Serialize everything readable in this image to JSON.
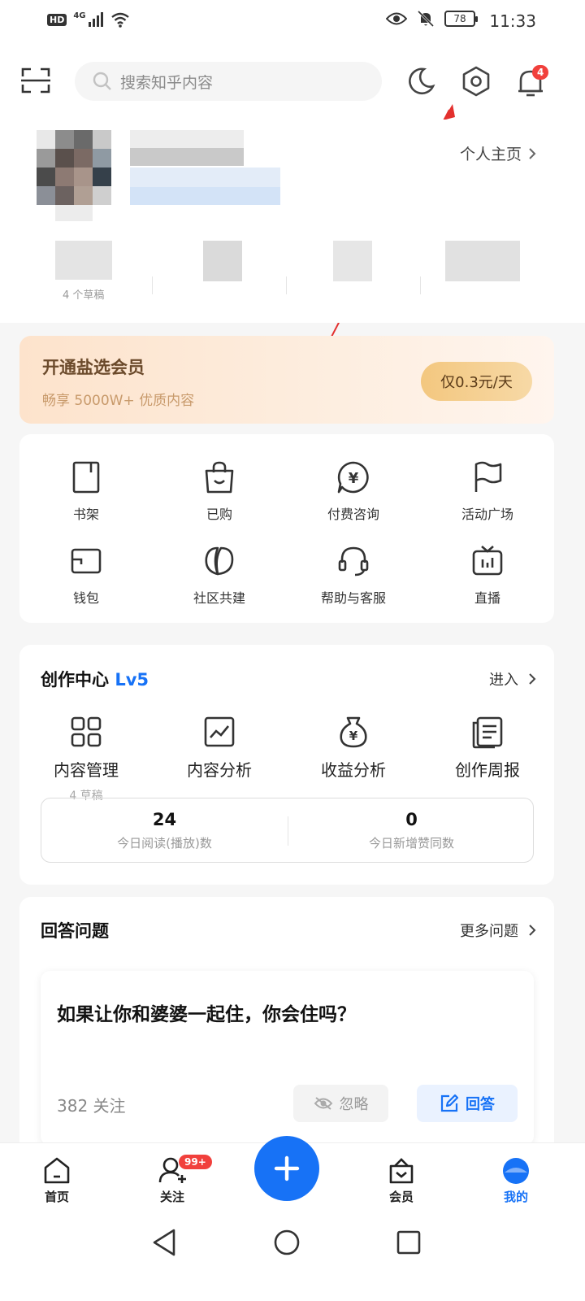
{
  "status_bar": {
    "hd": "HD",
    "network": "4G",
    "battery": "78",
    "time": "11:33"
  },
  "header": {
    "search_placeholder": "搜索知乎内容",
    "notification_count": "4"
  },
  "profile": {
    "homepage_link": "个人主页",
    "drafts_note": "4 个草稿"
  },
  "vip": {
    "title": "开通盐选会员",
    "subtitle": "畅享 5000W+ 优质内容",
    "button": "仅0.3元/天"
  },
  "quick_menu": [
    {
      "label": "书架",
      "icon": "bookshelf-icon"
    },
    {
      "label": "已购",
      "icon": "shopping-bag-icon"
    },
    {
      "label": "付费咨询",
      "icon": "paid-consult-icon"
    },
    {
      "label": "活动广场",
      "icon": "flag-icon"
    },
    {
      "label": "钱包",
      "icon": "wallet-icon"
    },
    {
      "label": "社区共建",
      "icon": "leaf-icon"
    },
    {
      "label": "帮助与客服",
      "icon": "headset-icon"
    },
    {
      "label": "直播",
      "icon": "tv-icon"
    }
  ],
  "creation_center": {
    "title": "创作中心",
    "level": "Lv5",
    "enter": "进入",
    "items": [
      {
        "label": "内容管理",
        "sub": "4 草稿",
        "icon": "grid-icon"
      },
      {
        "label": "内容分析",
        "sub": "",
        "icon": "chart-icon"
      },
      {
        "label": "收益分析",
        "sub": "",
        "icon": "money-bag-icon"
      },
      {
        "label": "创作周报",
        "sub": "",
        "icon": "report-icon"
      }
    ],
    "stats": [
      {
        "value": "24",
        "label": "今日阅读(播放)数"
      },
      {
        "value": "0",
        "label": "今日新增赞同数"
      }
    ]
  },
  "answer_section": {
    "title": "回答问题",
    "more": "更多问题",
    "question": "如果让你和婆婆一起住，你会住吗？",
    "follow_count": "382 关注",
    "ignore": "忽略",
    "answer": "回答"
  },
  "tabbar": {
    "tabs": [
      {
        "label": "首页"
      },
      {
        "label": "关注",
        "badge": "99+"
      },
      {
        "label": "会员"
      },
      {
        "label": "我的"
      }
    ]
  },
  "colors": {
    "accent": "#1772f6",
    "badge": "#f1403c",
    "vip_text": "#6b4a2b"
  }
}
